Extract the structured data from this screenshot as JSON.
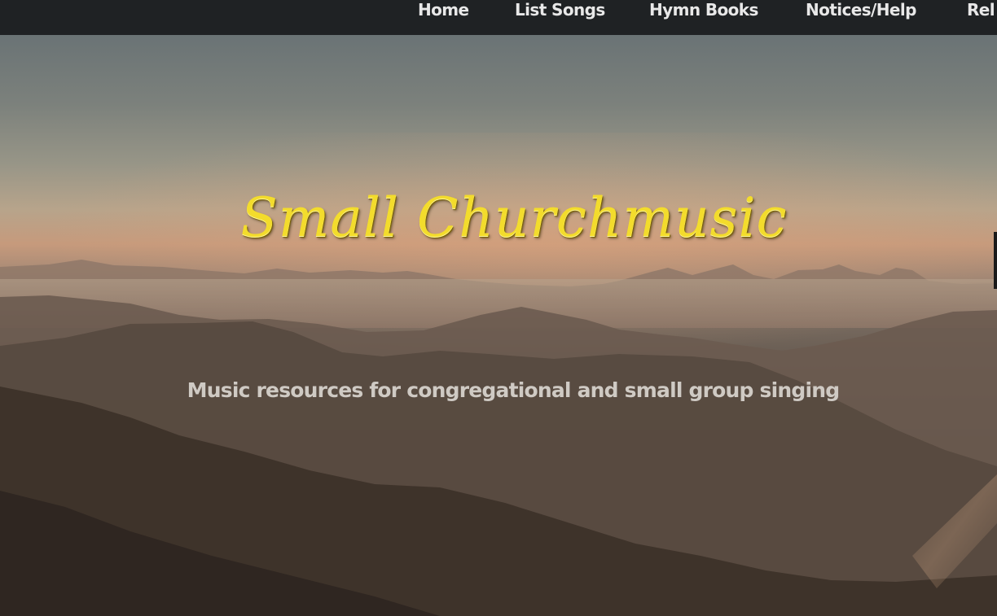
{
  "nav": {
    "items": [
      {
        "label": "Home"
      },
      {
        "label": "List Songs"
      },
      {
        "label": "Hymn Books"
      },
      {
        "label": "Notices/Help"
      },
      {
        "label": "Rel"
      }
    ]
  },
  "hero": {
    "title": "Small Churchmusic",
    "tagline": "Music resources for congregational and small group singing"
  },
  "colors": {
    "nav_background": "#1f2224",
    "nav_text": "#e8e8e8",
    "title_gold": "#f3dc2c",
    "tagline": "#cfcac4"
  }
}
